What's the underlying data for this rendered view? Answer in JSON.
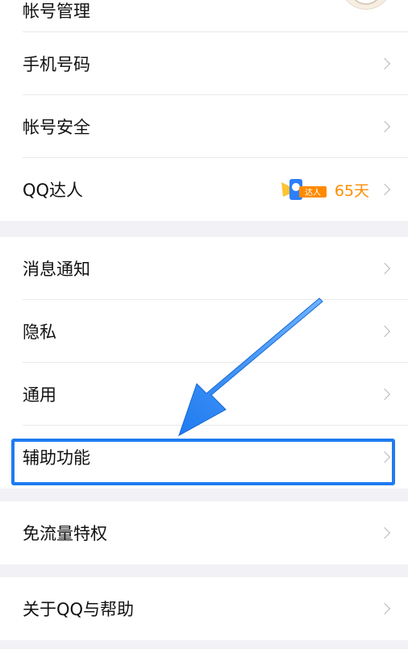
{
  "account_group": {
    "items": [
      {
        "label": "帐号管理"
      },
      {
        "label": "手机号码"
      },
      {
        "label": "帐号安全"
      },
      {
        "label": "QQ达人"
      }
    ],
    "qq_master": {
      "badge_icon": "qq-master-badge-icon",
      "badge_text": "达人",
      "days": "65天"
    }
  },
  "settings_group": {
    "items": [
      {
        "label": "消息通知"
      },
      {
        "label": "隐私"
      },
      {
        "label": "通用"
      },
      {
        "label": "辅助功能"
      }
    ]
  },
  "data_group": {
    "items": [
      {
        "label": "免流量特权"
      }
    ]
  },
  "about_group": {
    "items": [
      {
        "label": "关于QQ与帮助"
      }
    ]
  },
  "annotation": {
    "arrow_color": "#1f7bf0",
    "highlight_color": "#1f7bf0"
  }
}
